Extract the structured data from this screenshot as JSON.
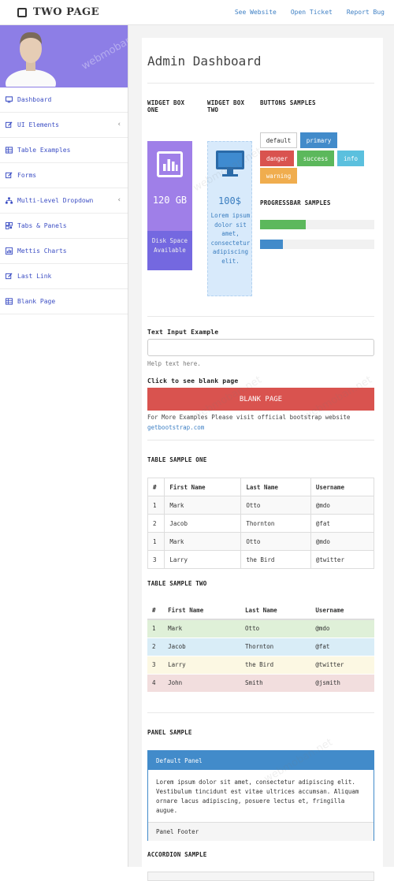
{
  "brand": {
    "title": "TWO PAGE"
  },
  "top_links": [
    "See Website",
    "Open Ticket",
    "Report Bug"
  ],
  "sidebar": {
    "items": [
      {
        "label": "Dashboard",
        "icon": "monitor-icon",
        "chevron": false
      },
      {
        "label": "UI Elements",
        "icon": "edit-icon",
        "chevron": true
      },
      {
        "label": "Table Examples",
        "icon": "table-icon",
        "chevron": false
      },
      {
        "label": "Forms",
        "icon": "edit-icon",
        "chevron": false
      },
      {
        "label": "Multi-Level Dropdown",
        "icon": "sitemap-icon",
        "chevron": true
      },
      {
        "label": "Tabs & Panels",
        "icon": "qrcode-icon",
        "chevron": false
      },
      {
        "label": "Mettis Charts",
        "icon": "bar-chart-icon",
        "chevron": false
      },
      {
        "label": "Last Link",
        "icon": "edit-icon",
        "chevron": false
      },
      {
        "label": "Blank Page",
        "icon": "table-icon",
        "chevron": false
      }
    ]
  },
  "main": {
    "title": "Admin Dashboard",
    "widget_one": {
      "heading": "WIDGET BOX ONE",
      "value": "120 GB",
      "caption": "Disk Space Available"
    },
    "widget_two": {
      "heading": "WIDGET BOX TWO",
      "value": "100$",
      "text": "Lorem ipsum dolor sit amet, consectetur adipiscing elit."
    },
    "buttons_heading": "BUTTONS SAMPLES",
    "buttons": [
      "default",
      "primary",
      "danger",
      "success",
      "info",
      "warning"
    ],
    "progress_heading": "PROGRESSBAR SAMPLES",
    "progress": [
      0.4,
      0.2
    ],
    "text_input": {
      "label": "Text Input Example",
      "help": "Help text here."
    },
    "blank_heading": "Click to see blank page",
    "blank_button": "BLANK PAGE",
    "more_text": "For More Examples Please visit official bootstrap website",
    "more_link": "getbootstrap.com",
    "table_one": {
      "heading": "TABLE SAMPLE ONE",
      "columns": [
        "#",
        "First Name",
        "Last Name",
        "Username"
      ],
      "rows": [
        [
          "1",
          "Mark",
          "Otto",
          "@mdo"
        ],
        [
          "2",
          "Jacob",
          "Thornton",
          "@fat"
        ],
        [
          "1",
          "Mark",
          "Otto",
          "@mdo"
        ],
        [
          "3",
          "Larry",
          "the Bird",
          "@twitter"
        ]
      ]
    },
    "table_two": {
      "heading": "TABLE SAMPLE TWO",
      "columns": [
        "#",
        "First Name",
        "Last Name",
        "Username"
      ],
      "rows": [
        [
          "1",
          "Mark",
          "Otto",
          "@mdo"
        ],
        [
          "2",
          "Jacob",
          "Thornton",
          "@fat"
        ],
        [
          "3",
          "Larry",
          "the Bird",
          "@twitter"
        ],
        [
          "4",
          "John",
          "Smith",
          "@jsmith"
        ]
      ],
      "row_colors": [
        "#dff0d8",
        "#d9edf7",
        "#fcf8e3",
        "#f2dede"
      ]
    },
    "panel": {
      "heading": "PANEL SAMPLE",
      "title": "Default Panel",
      "body": "Lorem ipsum dolor sit amet, consectetur adipiscing elit. Vestibulum tincidunt est vitae ultrices accumsan. Aliquam ornare lacus adipiscing, posuere lectus et, fringilla augue.",
      "footer": "Panel Footer"
    },
    "accordion_heading": "ACCORDION SAMPLE"
  },
  "colors": {
    "accent": "#428bca",
    "purple": "#9f7fe8",
    "danger": "#d9534f",
    "success": "#5cb85c",
    "info": "#5bc0de",
    "warning": "#f0ad4e",
    "primary": "#428bca"
  }
}
